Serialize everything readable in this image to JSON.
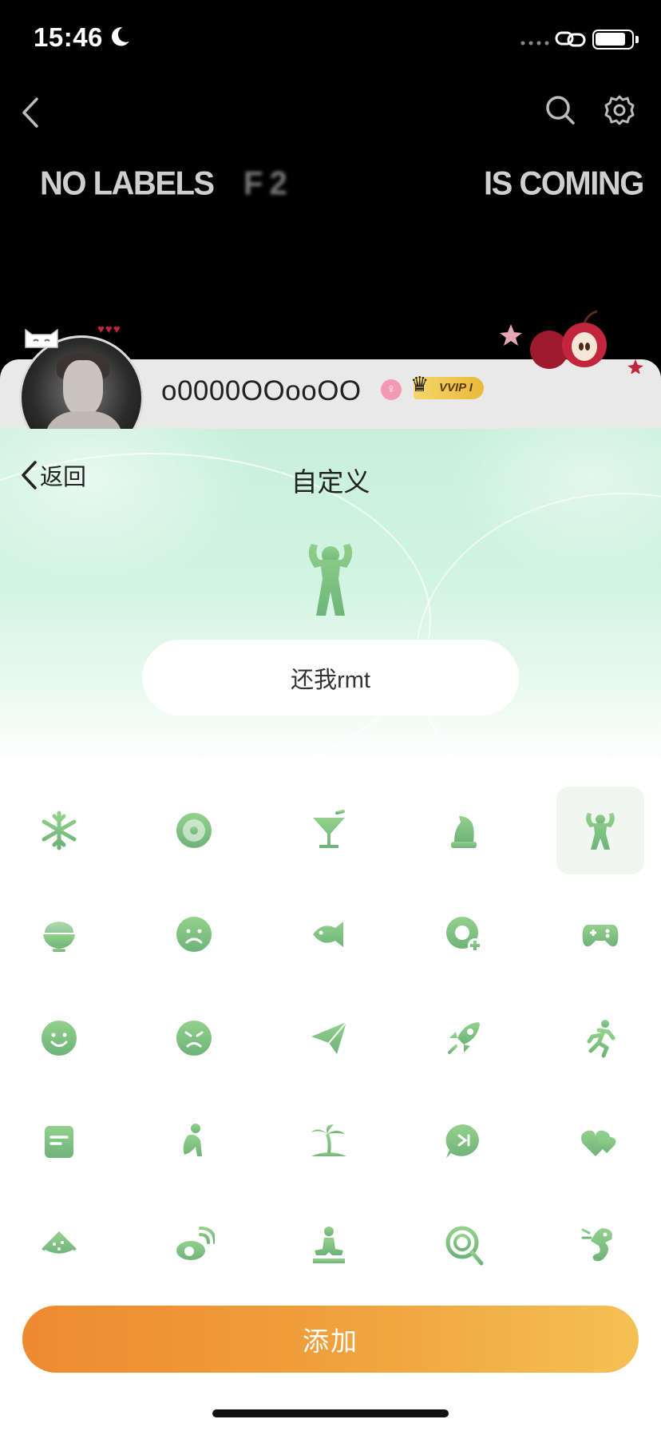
{
  "status_bar": {
    "time": "15:46",
    "battery_level": 0.85
  },
  "profile_background": {
    "banner_items": [
      "NO LABELS",
      "F 2",
      "IS COMING"
    ],
    "username": "o0000OOooOO",
    "gender_symbol": "♀",
    "vip_label": "VVIP I",
    "icons": [
      "back-icon",
      "search-icon",
      "gear-icon"
    ]
  },
  "sheet": {
    "back_label": "返回",
    "title": "自定义",
    "preview_icon": "muscle-person-icon",
    "name_value": "还我rmt",
    "accent_color": "#7dc280",
    "icon_grid": [
      {
        "icon": "snowflake-icon",
        "selected": false
      },
      {
        "icon": "flower-badge-icon",
        "selected": false
      },
      {
        "icon": "cocktail-icon",
        "selected": false
      },
      {
        "icon": "chess-knight-icon",
        "selected": false
      },
      {
        "icon": "muscle-person-icon",
        "selected": true
      },
      {
        "icon": "rice-bowl-icon",
        "selected": false
      },
      {
        "icon": "sad-face-icon",
        "selected": false
      },
      {
        "icon": "fish-icon",
        "selected": false
      },
      {
        "icon": "chat-add-icon",
        "selected": false
      },
      {
        "icon": "gamepad-icon",
        "selected": false
      },
      {
        "icon": "smile-face-icon",
        "selected": false
      },
      {
        "icon": "angry-face-icon",
        "selected": false
      },
      {
        "icon": "paper-plane-icon",
        "selected": false
      },
      {
        "icon": "rocket-icon",
        "selected": false
      },
      {
        "icon": "running-person-icon",
        "selected": false
      },
      {
        "icon": "note-icon",
        "selected": false
      },
      {
        "icon": "sitting-person-icon",
        "selected": false
      },
      {
        "icon": "palm-island-icon",
        "selected": false
      },
      {
        "icon": "chat-play-icon",
        "selected": false
      },
      {
        "icon": "double-heart-icon",
        "selected": false
      },
      {
        "icon": "watermelon-icon",
        "selected": false
      },
      {
        "icon": "weibo-icon",
        "selected": false
      },
      {
        "icon": "meditation-icon",
        "selected": false
      },
      {
        "icon": "lollipop-icon",
        "selected": false
      },
      {
        "icon": "seahorse-icon",
        "selected": false
      }
    ],
    "add_button_label": "添加"
  }
}
